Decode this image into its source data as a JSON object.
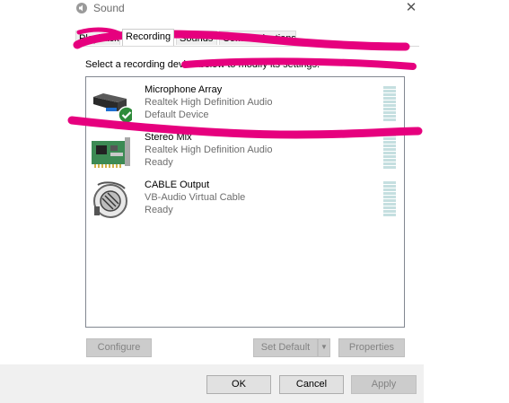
{
  "window": {
    "title": "Sound",
    "icon": "speaker-icon",
    "close_glyph": "✕"
  },
  "tabs": [
    {
      "label": "Playback",
      "active": false
    },
    {
      "label": "Recording",
      "active": true
    },
    {
      "label": "Sounds",
      "active": false
    },
    {
      "label": "Communications",
      "active": false
    }
  ],
  "prompt": "Select a recording device below to modify its settings:",
  "devices": [
    {
      "name": "Microphone Array",
      "driver": "Realtek High Definition Audio",
      "status": "Default Device",
      "icon": "microphone-array-icon",
      "default": true
    },
    {
      "name": "Stereo Mix",
      "driver": "Realtek High Definition Audio",
      "status": "Ready",
      "icon": "sound-card-icon",
      "default": false
    },
    {
      "name": "CABLE Output",
      "driver": "VB-Audio Virtual Cable",
      "status": "Ready",
      "icon": "cable-device-icon",
      "default": false
    }
  ],
  "buttons": {
    "configure": "Configure",
    "set_default": "Set Default",
    "properties": "Properties",
    "ok": "OK",
    "cancel": "Cancel",
    "apply": "Apply"
  },
  "colors": {
    "annotation_stroke": "#e6007e",
    "default_check": "#2e8b3a"
  }
}
